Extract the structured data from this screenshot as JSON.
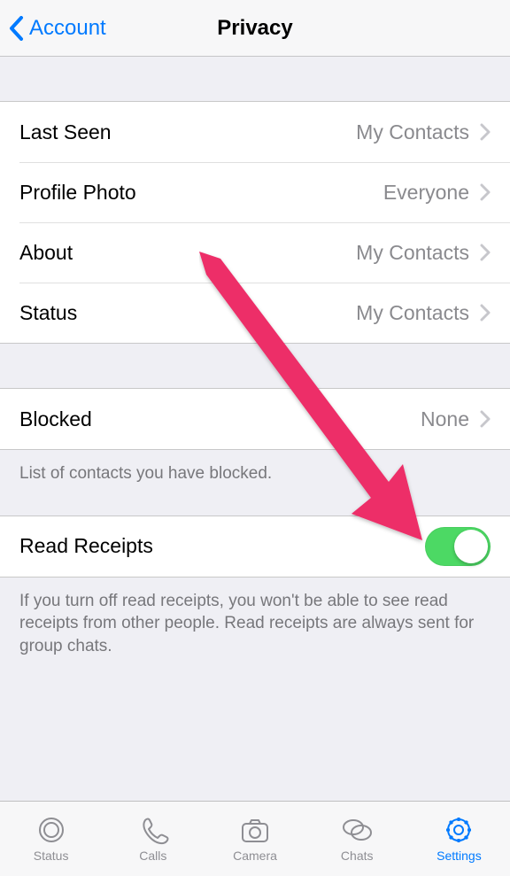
{
  "header": {
    "back_label": "Account",
    "title": "Privacy"
  },
  "privacy_rows": [
    {
      "label": "Last Seen",
      "value": "My Contacts"
    },
    {
      "label": "Profile Photo",
      "value": "Everyone"
    },
    {
      "label": "About",
      "value": "My Contacts"
    },
    {
      "label": "Status",
      "value": "My Contacts"
    }
  ],
  "blocked": {
    "label": "Blocked",
    "value": "None"
  },
  "blocked_footer": "List of contacts you have blocked.",
  "read_receipts": {
    "label": "Read Receipts",
    "on": true
  },
  "read_receipts_footer": "If you turn off read receipts, you won't be able to see read receipts from other people. Read receipts are always sent for group chats.",
  "tabs": [
    {
      "label": "Status"
    },
    {
      "label": "Calls"
    },
    {
      "label": "Camera"
    },
    {
      "label": "Chats"
    },
    {
      "label": "Settings"
    }
  ],
  "active_tab": 4
}
